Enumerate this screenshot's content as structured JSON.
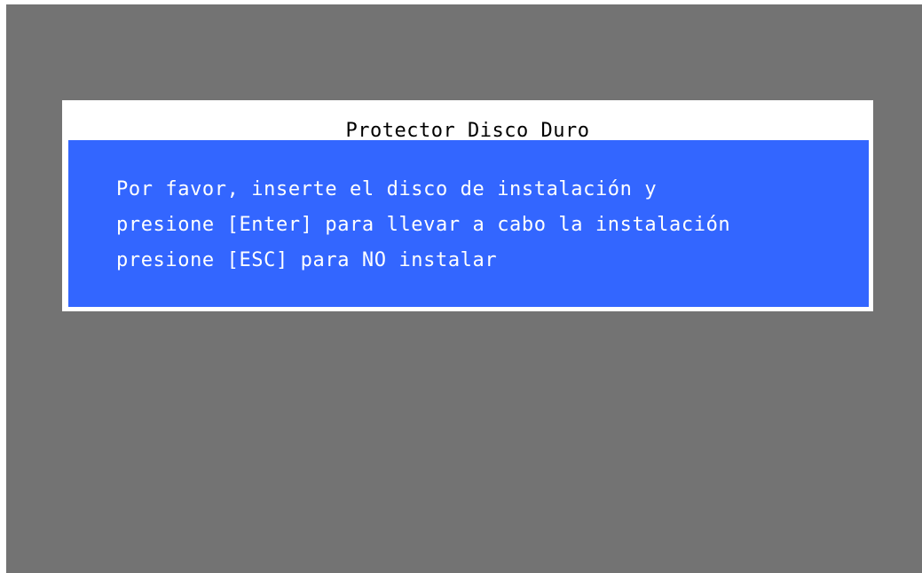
{
  "colors": {
    "background": "#737373",
    "dialog_frame": "#ffffff",
    "dialog_body": "#3366ff",
    "title_text": "#000000",
    "message_text": "#ffffff"
  },
  "dialog": {
    "title": "Protector Disco Duro",
    "lines": [
      "Por favor, inserte el disco de instalación y",
      "presione [Enter] para llevar a cabo la instalación",
      "presione [ESC] para NO instalar"
    ]
  }
}
